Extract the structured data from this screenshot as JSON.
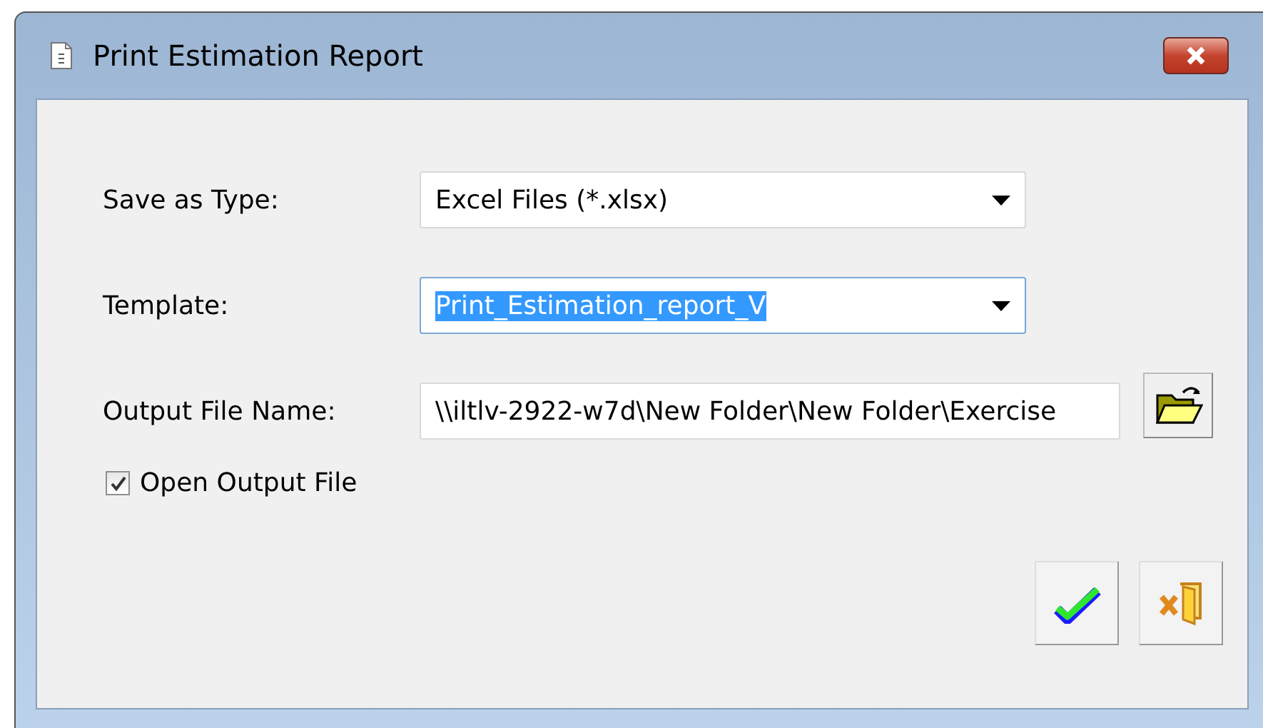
{
  "window": {
    "title": "Print Estimation Report"
  },
  "fields": [
    {
      "kind": "dropdown",
      "label": "Save as Type:",
      "value": "Excel Files (*.xlsx)",
      "text_selected": false
    },
    {
      "kind": "dropdown",
      "label": "Template:",
      "value": "Print_Estimation_report_V",
      "text_selected": true
    },
    {
      "kind": "browse",
      "label": "Output File Name:",
      "value": "\\\\iltlv-2922-w7d\\New Folder\\New Folder\\Exercise",
      "text_selected": false
    }
  ],
  "open_output_file": {
    "label": "Open Output File",
    "checked": true
  }
}
